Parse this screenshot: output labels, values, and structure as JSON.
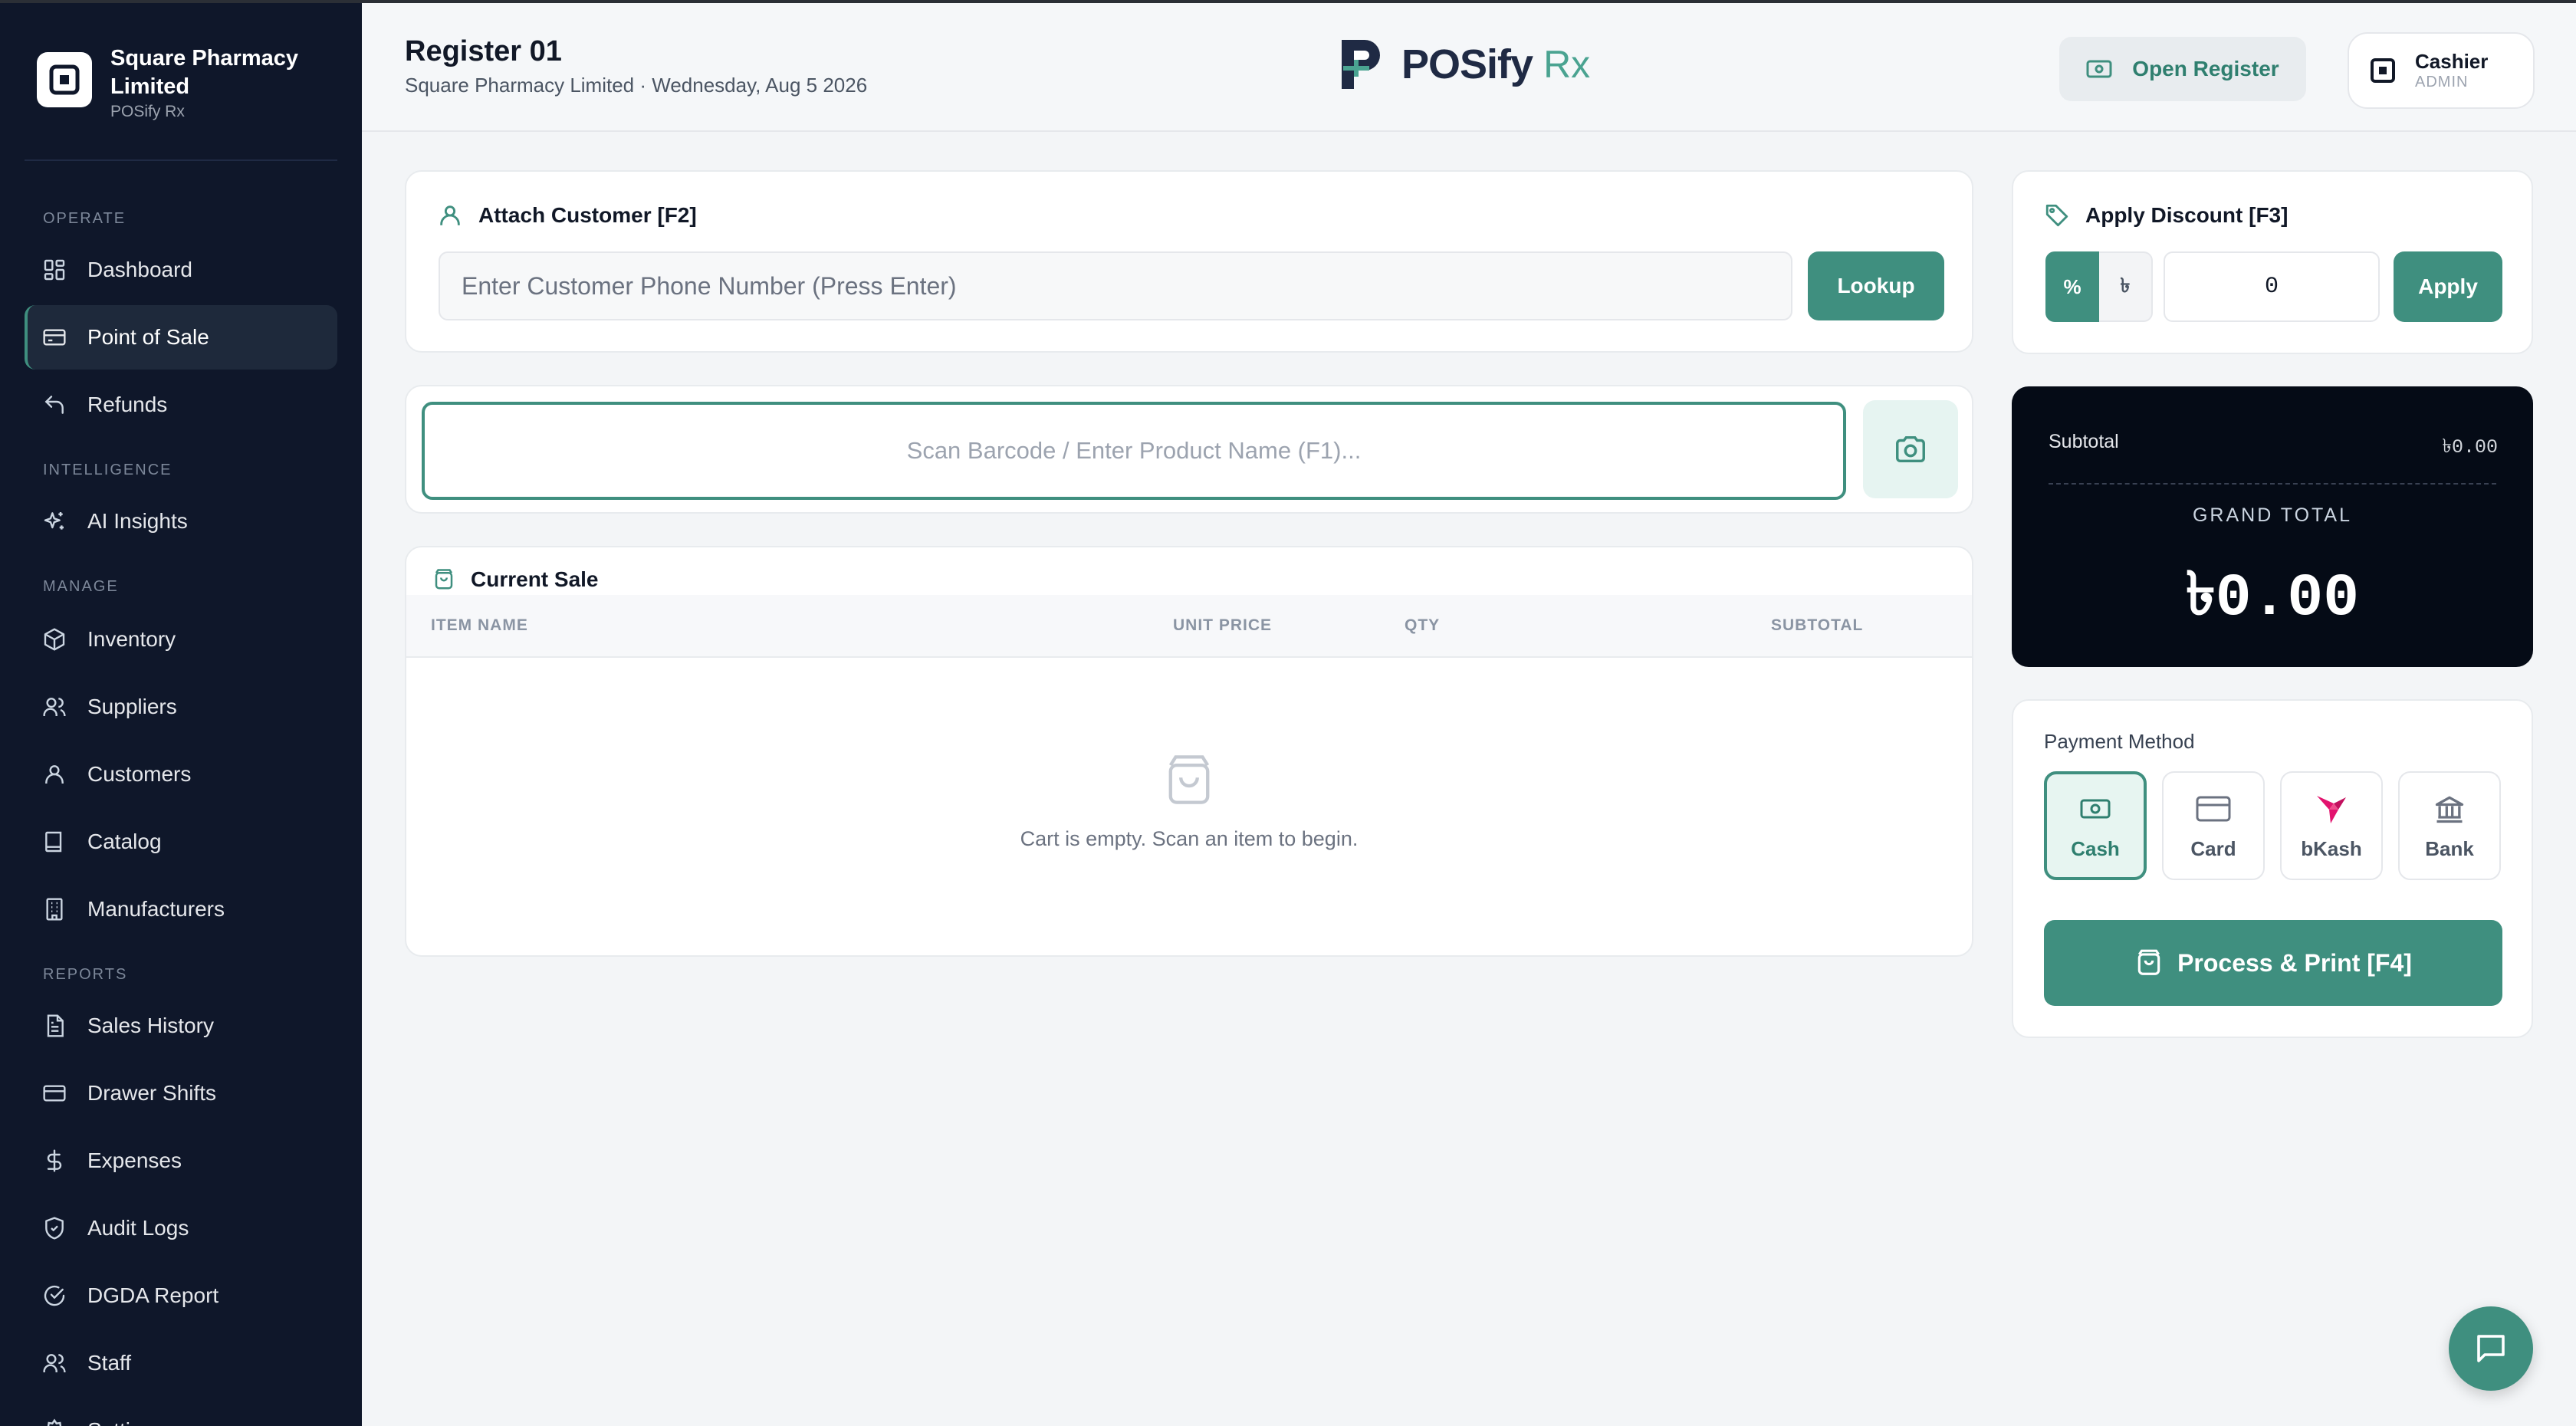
{
  "colors": {
    "accent": "#3f8f7f",
    "sidebar_bg": "#0f172a",
    "totals_bg": "#050b16",
    "logo_rx": "#4aa391"
  },
  "sidebar": {
    "brand_name": "Square Pharmacy Limited",
    "brand_sub": "POSify Rx",
    "sections": {
      "operate": "OPERATE",
      "intelligence": "INTELLIGENCE",
      "manage": "MANAGE",
      "reports": "REPORTS"
    },
    "items": [
      {
        "label": "Dashboard",
        "icon": "dashboard-grid-icon"
      },
      {
        "label": "Point of Sale",
        "icon": "credit-card-icon",
        "active": true
      },
      {
        "label": "Refunds",
        "icon": "undo-arrow-icon"
      },
      {
        "label": "AI Insights",
        "icon": "sparkles-icon"
      },
      {
        "label": "Inventory",
        "icon": "package-box-icon"
      },
      {
        "label": "Suppliers",
        "icon": "users-icon"
      },
      {
        "label": "Customers",
        "icon": "user-icon"
      },
      {
        "label": "Catalog",
        "icon": "book-icon"
      },
      {
        "label": "Manufacturers",
        "icon": "building-icon"
      },
      {
        "label": "Sales History",
        "icon": "file-text-icon"
      },
      {
        "label": "Drawer Shifts",
        "icon": "credit-card-icon"
      },
      {
        "label": "Expenses",
        "icon": "dollar-sign-icon"
      },
      {
        "label": "Audit Logs",
        "icon": "shield-check-icon"
      },
      {
        "label": "DGDA Report",
        "icon": "circle-check-icon"
      },
      {
        "label": "Staff",
        "icon": "users-icon"
      },
      {
        "label": "Settings",
        "icon": "gear-icon"
      }
    ]
  },
  "header": {
    "register_title": "Register 01",
    "register_sub": "Square Pharmacy Limited · Wednesday, Aug 5 2026",
    "logo_text": "POSify",
    "logo_rx": "Rx",
    "open_register_label": "Open Register",
    "cashier_name": "Cashier",
    "cashier_role": "ADMIN"
  },
  "customer": {
    "title": "Attach Customer [F2]",
    "placeholder": "Enter Customer Phone Number (Press Enter)",
    "lookup_label": "Lookup"
  },
  "scan": {
    "placeholder": "Scan Barcode / Enter Product Name (F1)..."
  },
  "sale": {
    "title": "Current Sale",
    "columns": [
      "ITEM NAME",
      "UNIT PRICE",
      "QTY",
      "SUBTOTAL"
    ],
    "rows": [],
    "empty_text": "Cart is empty. Scan an item to begin."
  },
  "discount": {
    "title": "Apply Discount [F3]",
    "mode_percent": "%",
    "mode_currency": "৳",
    "value": "0",
    "apply_label": "Apply"
  },
  "totals": {
    "subtotal_label": "Subtotal",
    "subtotal_value": "৳0.00",
    "grand_total_label": "GRAND TOTAL",
    "grand_total_value": "৳0.00"
  },
  "payment": {
    "label": "Payment Method",
    "methods": [
      {
        "label": "Cash",
        "icon": "banknote-icon",
        "selected": true
      },
      {
        "label": "Card",
        "icon": "credit-card-icon"
      },
      {
        "label": "bKash",
        "icon": "bkash-bird-icon"
      },
      {
        "label": "Bank",
        "icon": "bank-building-icon"
      }
    ],
    "process_label": "Process & Print [F4]"
  }
}
